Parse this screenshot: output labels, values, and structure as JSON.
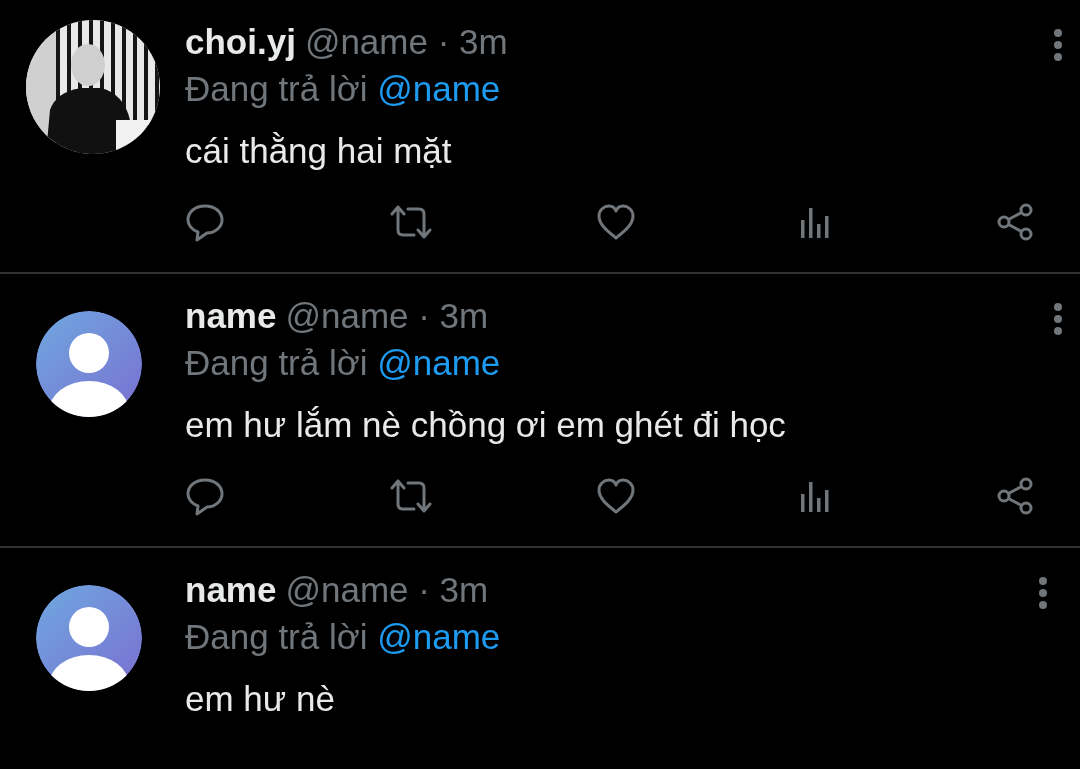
{
  "tweets": [
    {
      "name": "choi.yj",
      "meta": "@name · 3m",
      "reply_label": "Đang trả lời",
      "reply_to": "@name",
      "text": "cái thằng hai mặt",
      "actions_visible": true
    },
    {
      "avatar": {
        "kind": "default"
      },
      "name": "name",
      "meta": "@name · 3m",
      "reply_label": "Đang trả lời",
      "reply_to": "@name",
      "text": "em hư lắm nè chồng ơi em ghét đi học",
      "actions_visible": true
    },
    {
      "avatar": {
        "kind": "default"
      },
      "name": "name",
      "meta": "@name · 3m",
      "reply_label": "Đang trả lời",
      "reply_to": "@name",
      "text": "em hư nè",
      "actions_visible": false
    }
  ]
}
